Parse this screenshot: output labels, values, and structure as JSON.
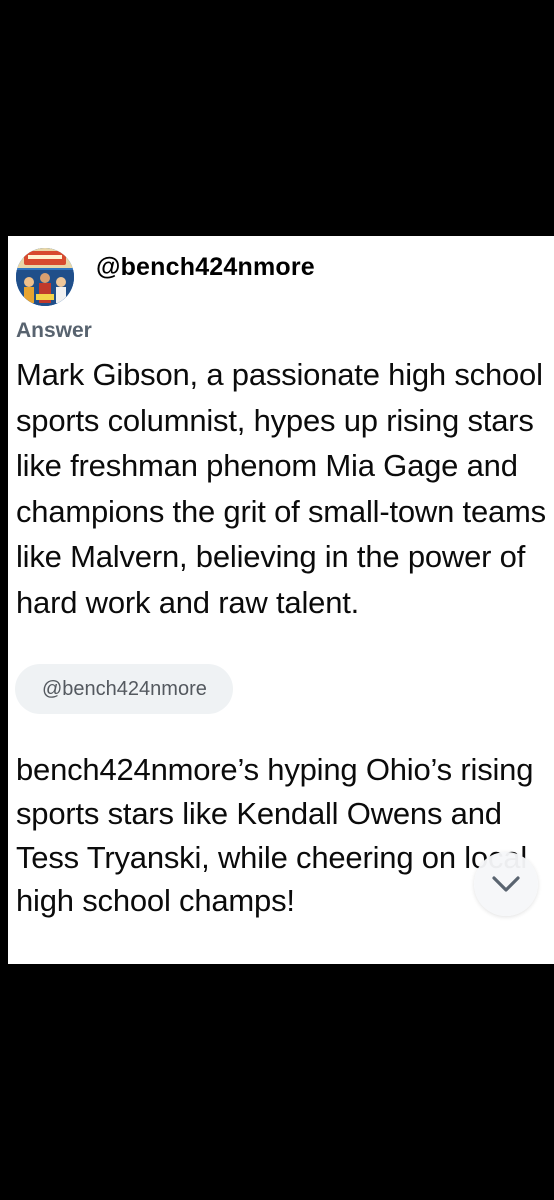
{
  "post": {
    "handle": "@bench424nmore",
    "answer_label": "Answer",
    "answer_text": "Mark Gibson, a passionate high school sports columnist, hypes up rising stars like freshman phenom Mia Gage and champions the grit of small-town teams like Malvern, believing in the power of hard work and raw talent.",
    "mention_chip": "@bench424nmore",
    "summary_text": "bench424nmore’s hyping Ohio’s rising sports stars like Kendall Owens and Tess Tryanski, while cheering on local high school champs!"
  },
  "icons": {
    "avatar": "profile-avatar",
    "scroll": "chevron-down-icon"
  },
  "colors": {
    "page_background": "#000000",
    "card_background": "#ffffff",
    "label_gray": "#58636f",
    "chip_background": "#eff2f4"
  }
}
